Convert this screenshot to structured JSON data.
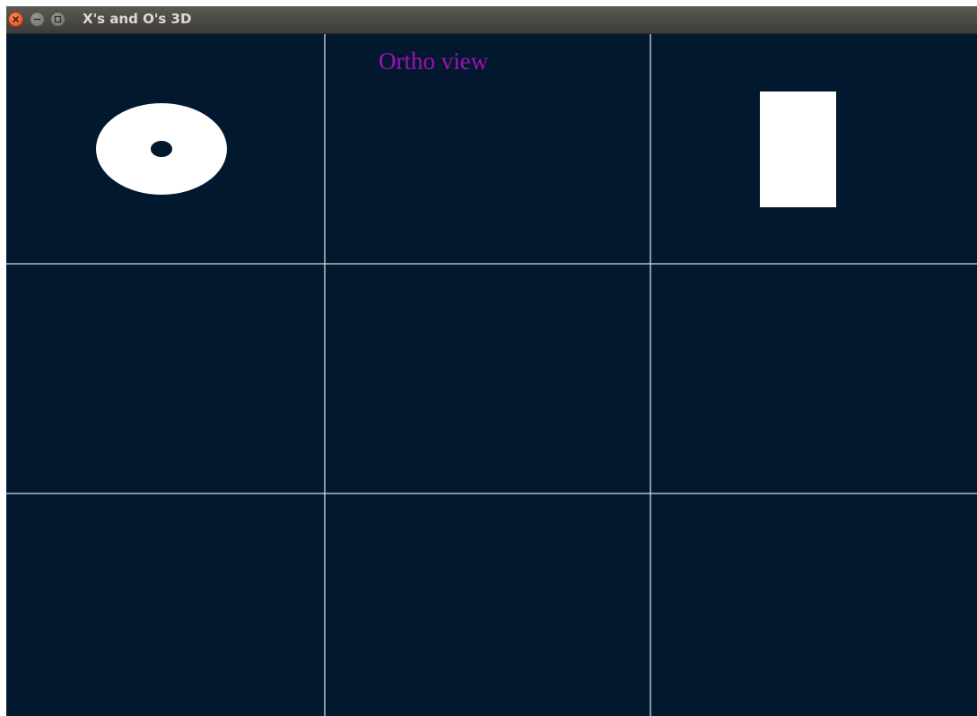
{
  "window": {
    "title": "X's and O's 3D",
    "controls": [
      "close-icon",
      "minimize-icon",
      "maximize-icon"
    ]
  },
  "view": {
    "label": "Ortho view",
    "label_color": "#a010b4",
    "background": "#01182f",
    "grid_color": "#d8d8d8",
    "piece_color": "#ffffff"
  },
  "board": {
    "rows": 3,
    "cols": 3,
    "cells": [
      [
        "O",
        "",
        "X"
      ],
      [
        "",
        "",
        ""
      ],
      [
        "",
        "",
        ""
      ]
    ]
  }
}
